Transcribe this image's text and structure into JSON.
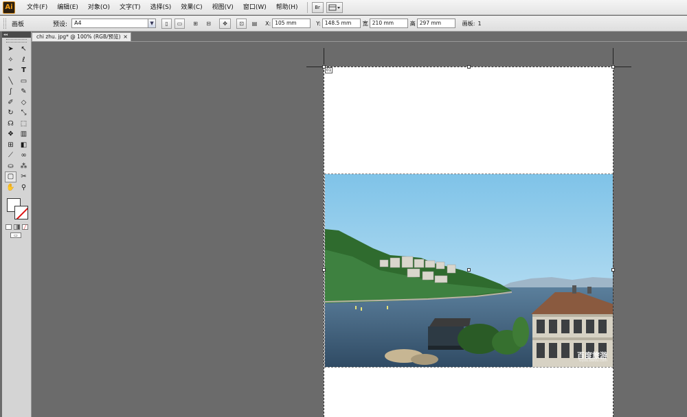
{
  "menu": {
    "logo": "Ai",
    "items": [
      "文件(F)",
      "编辑(E)",
      "对象(O)",
      "文字(T)",
      "选择(S)",
      "效果(C)",
      "视图(V)",
      "窗口(W)",
      "帮助(H)"
    ],
    "bridge_label": "Br",
    "icons": [
      "bridge-icon",
      "arrange-documents-icon"
    ]
  },
  "control": {
    "panel_label": "画板",
    "preset_label": "预设:",
    "preset_value": "A4",
    "x_label": "X:",
    "x_value": "105 mm",
    "y_label": "Y:",
    "y_value": "148.5 mm",
    "w_label": "宽",
    "w_value": "210 mm",
    "h_label": "高",
    "h_value": "297 mm",
    "artboards_label": "画板:",
    "artboards_value": "1"
  },
  "document": {
    "tab_title": "chi zhu. jpg* @ 100% (RGB/预览)",
    "close": "×",
    "artboard_number": "01"
  },
  "toolbox": {
    "header": "◂◂",
    "tools": [
      "selection",
      "direct-selection",
      "magic-wand",
      "lasso",
      "pen",
      "type",
      "line-segment",
      "rectangle",
      "paintbrush",
      "pencil",
      "blob-brush",
      "eraser",
      "rotate",
      "scale",
      "warp",
      "free-transform",
      "symbol-sprayer",
      "column-graph",
      "mesh",
      "gradient",
      "eyedropper",
      "blend",
      "live-paint-bucket",
      "live-paint-selection",
      "artboard",
      "slice",
      "hand",
      "zoom"
    ]
  },
  "photo": {
    "watermark_main": "百度旅游",
    "watermark_sub": "lvyou.baidu.com"
  },
  "colors": {
    "canvas": "#6b6b6b",
    "sky_top": "#7fc3e8",
    "sea": "#3d5b78",
    "hill": "#2f6b2e"
  }
}
